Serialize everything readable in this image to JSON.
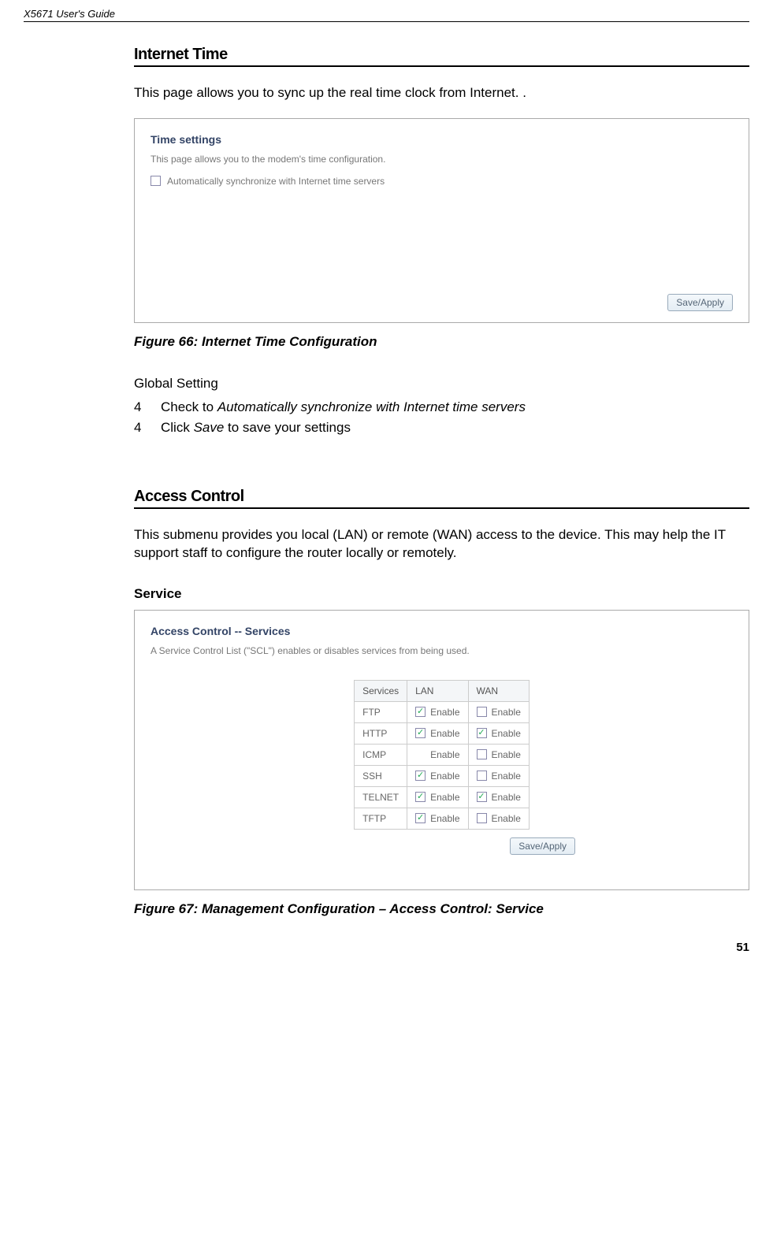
{
  "header": {
    "doc_title": "X5671 User's Guide"
  },
  "section1": {
    "title": "Internet Time",
    "intro": "This page allows you to sync up the real time clock from Internet. .",
    "figure": {
      "title": "Time settings",
      "desc": "This page allows you to the modem's time configuration.",
      "checkbox_label": "Automatically synchronize with Internet time servers",
      "button": "Save/Apply"
    },
    "caption": "Figure 66: Internet Time Configuration",
    "global_setting_label": "Global Setting",
    "steps": [
      {
        "num": "4",
        "text_prefix": "Check to ",
        "italic": "Automatically synchronize with Internet time servers",
        "text_suffix": ""
      },
      {
        "num": "4",
        "text_prefix": "Click ",
        "italic": "Save",
        "text_suffix": " to save your settings"
      }
    ]
  },
  "section2": {
    "title": "Access Control",
    "intro": "This submenu provides you local (LAN) or remote (WAN) access to the device. This may help the IT support staff to configure the router locally or remotely.",
    "subhead": "Service",
    "figure": {
      "title": "Access Control -- Services",
      "desc": "A Service Control List (\"SCL\") enables or disables services from being used.",
      "table": {
        "headers": [
          "Services",
          "LAN",
          "WAN"
        ],
        "rows": [
          {
            "svc": "FTP",
            "lan": {
              "checked": true,
              "label": "Enable",
              "show_box": true
            },
            "wan": {
              "checked": false,
              "label": "Enable",
              "show_box": true
            }
          },
          {
            "svc": "HTTP",
            "lan": {
              "checked": true,
              "label": "Enable",
              "show_box": true
            },
            "wan": {
              "checked": true,
              "label": "Enable",
              "show_box": true
            }
          },
          {
            "svc": "ICMP",
            "lan": {
              "checked": false,
              "label": "Enable",
              "show_box": false
            },
            "wan": {
              "checked": false,
              "label": "Enable",
              "show_box": true
            }
          },
          {
            "svc": "SSH",
            "lan": {
              "checked": true,
              "label": "Enable",
              "show_box": true
            },
            "wan": {
              "checked": false,
              "label": "Enable",
              "show_box": true
            }
          },
          {
            "svc": "TELNET",
            "lan": {
              "checked": true,
              "label": "Enable",
              "show_box": true
            },
            "wan": {
              "checked": true,
              "label": "Enable",
              "show_box": true
            }
          },
          {
            "svc": "TFTP",
            "lan": {
              "checked": true,
              "label": "Enable",
              "show_box": true
            },
            "wan": {
              "checked": false,
              "label": "Enable",
              "show_box": true
            }
          }
        ]
      },
      "button": "Save/Apply"
    },
    "caption": "Figure 67: Management Configuration – Access Control: Service"
  },
  "page_number": "51"
}
